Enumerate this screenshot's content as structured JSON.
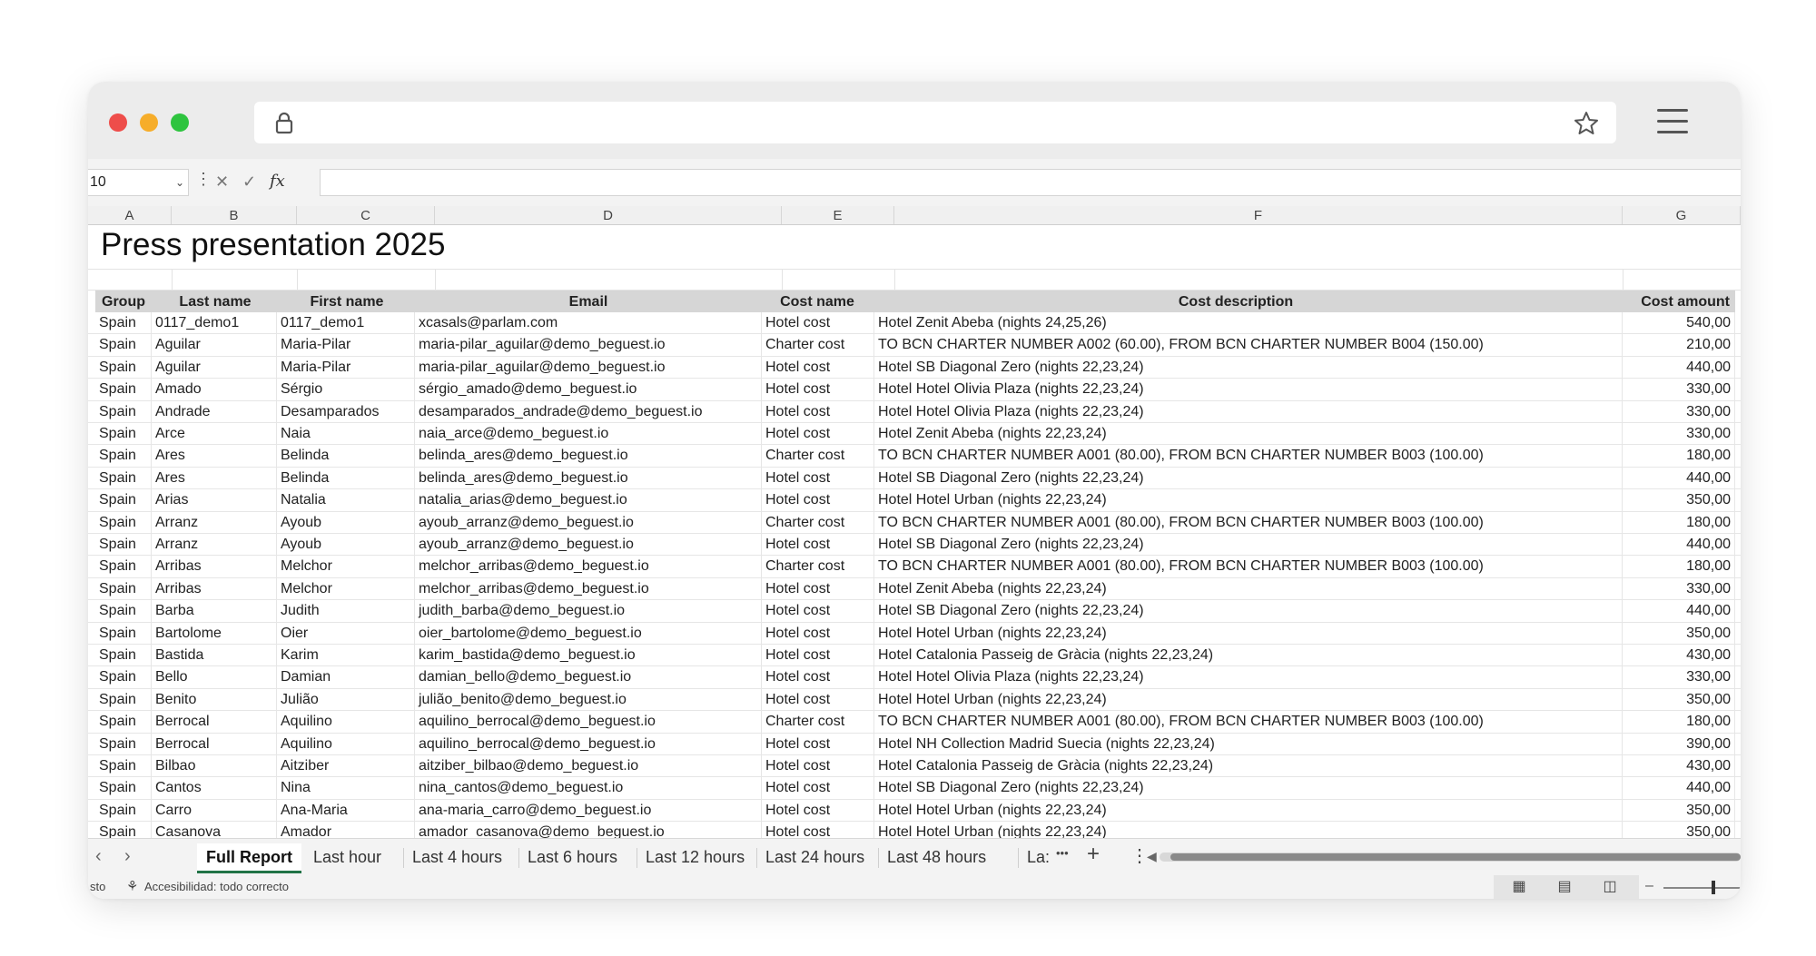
{
  "browser": {
    "star_icon": "star-icon",
    "lock_icon": "lock-icon",
    "menu_icon": "hamburger-menu-icon",
    "traffic": {
      "close": "#ee4d4a",
      "minimize": "#f6ad2a",
      "maximize": "#2ec43f"
    }
  },
  "formula_bar": {
    "name_box": "10",
    "fx": "fx"
  },
  "columns": [
    "A",
    "B",
    "C",
    "D",
    "E",
    "F",
    "G"
  ],
  "sheet_title": "Press presentation 2025",
  "headers": {
    "group": "Group",
    "last_name": "Last name",
    "first_name": "First name",
    "email": "Email",
    "cost_name": "Cost name",
    "cost_description": "Cost description",
    "cost_amount": "Cost amount"
  },
  "rows": [
    [
      "Spain",
      "0117_demo1",
      "0117_demo1",
      "xcasals@parlam.com",
      "Hotel cost",
      "Hotel Zenit Abeba (nights 24,25,26)",
      "540,00"
    ],
    [
      "Spain",
      "Aguilar",
      "Maria-Pilar",
      "maria-pilar_aguilar@demo_beguest.io",
      "Charter cost",
      "TO BCN CHARTER NUMBER A002 (60.00), FROM BCN CHARTER NUMBER B004 (150.00)",
      "210,00"
    ],
    [
      "Spain",
      "Aguilar",
      "Maria-Pilar",
      "maria-pilar_aguilar@demo_beguest.io",
      "Hotel cost",
      "Hotel SB Diagonal Zero (nights 22,23,24)",
      "440,00"
    ],
    [
      "Spain",
      "Amado",
      "Sérgio",
      "sérgio_amado@demo_beguest.io",
      "Hotel cost",
      "Hotel Hotel Olivia Plaza (nights 22,23,24)",
      "330,00"
    ],
    [
      "Spain",
      "Andrade",
      "Desamparados",
      "desamparados_andrade@demo_beguest.io",
      "Hotel cost",
      "Hotel Hotel Olivia Plaza (nights 22,23,24)",
      "330,00"
    ],
    [
      "Spain",
      "Arce",
      "Naia",
      "naia_arce@demo_beguest.io",
      "Hotel cost",
      "Hotel Zenit Abeba (nights 22,23,24)",
      "330,00"
    ],
    [
      "Spain",
      "Ares",
      "Belinda",
      "belinda_ares@demo_beguest.io",
      "Charter cost",
      "TO BCN CHARTER NUMBER A001 (80.00), FROM BCN CHARTER NUMBER B003 (100.00)",
      "180,00"
    ],
    [
      "Spain",
      "Ares",
      "Belinda",
      "belinda_ares@demo_beguest.io",
      "Hotel cost",
      "Hotel SB Diagonal Zero (nights 22,23,24)",
      "440,00"
    ],
    [
      "Spain",
      "Arias",
      "Natalia",
      "natalia_arias@demo_beguest.io",
      "Hotel cost",
      "Hotel Hotel Urban (nights 22,23,24)",
      "350,00"
    ],
    [
      "Spain",
      "Arranz",
      "Ayoub",
      "ayoub_arranz@demo_beguest.io",
      "Charter cost",
      "TO BCN CHARTER NUMBER A001 (80.00), FROM BCN CHARTER NUMBER B003 (100.00)",
      "180,00"
    ],
    [
      "Spain",
      "Arranz",
      "Ayoub",
      "ayoub_arranz@demo_beguest.io",
      "Hotel cost",
      "Hotel SB Diagonal Zero (nights 22,23,24)",
      "440,00"
    ],
    [
      "Spain",
      "Arribas",
      "Melchor",
      "melchor_arribas@demo_beguest.io",
      "Charter cost",
      "TO BCN CHARTER NUMBER A001 (80.00), FROM BCN CHARTER NUMBER B003 (100.00)",
      "180,00"
    ],
    [
      "Spain",
      "Arribas",
      "Melchor",
      "melchor_arribas@demo_beguest.io",
      "Hotel cost",
      "Hotel Zenit Abeba (nights 22,23,24)",
      "330,00"
    ],
    [
      "Spain",
      "Barba",
      "Judith",
      "judith_barba@demo_beguest.io",
      "Hotel cost",
      "Hotel SB Diagonal Zero (nights 22,23,24)",
      "440,00"
    ],
    [
      "Spain",
      "Bartolome",
      "Oier",
      "oier_bartolome@demo_beguest.io",
      "Hotel cost",
      "Hotel Hotel Urban (nights 22,23,24)",
      "350,00"
    ],
    [
      "Spain",
      "Bastida",
      "Karim",
      "karim_bastida@demo_beguest.io",
      "Hotel cost",
      "Hotel Catalonia Passeig de Gràcia (nights 22,23,24)",
      "430,00"
    ],
    [
      "Spain",
      "Bello",
      "Damian",
      "damian_bello@demo_beguest.io",
      "Hotel cost",
      "Hotel Hotel Olivia Plaza (nights 22,23,24)",
      "330,00"
    ],
    [
      "Spain",
      "Benito",
      "Julião",
      "julião_benito@demo_beguest.io",
      "Hotel cost",
      "Hotel Hotel Urban (nights 22,23,24)",
      "350,00"
    ],
    [
      "Spain",
      "Berrocal",
      "Aquilino",
      "aquilino_berrocal@demo_beguest.io",
      "Charter cost",
      "TO BCN CHARTER NUMBER A001 (80.00), FROM BCN CHARTER NUMBER B003 (100.00)",
      "180,00"
    ],
    [
      "Spain",
      "Berrocal",
      "Aquilino",
      "aquilino_berrocal@demo_beguest.io",
      "Hotel cost",
      "Hotel NH Collection Madrid Suecia (nights 22,23,24)",
      "390,00"
    ],
    [
      "Spain",
      "Bilbao",
      "Aitziber",
      "aitziber_bilbao@demo_beguest.io",
      "Hotel cost",
      "Hotel Catalonia Passeig de Gràcia (nights 22,23,24)",
      "430,00"
    ],
    [
      "Spain",
      "Cantos",
      "Nina",
      "nina_cantos@demo_beguest.io",
      "Hotel cost",
      "Hotel SB Diagonal Zero (nights 22,23,24)",
      "440,00"
    ],
    [
      "Spain",
      "Carro",
      "Ana-Maria",
      "ana-maria_carro@demo_beguest.io",
      "Hotel cost",
      "Hotel Hotel Urban (nights 22,23,24)",
      "350,00"
    ],
    [
      "Spain",
      "Casanova",
      "Amador",
      "amador_casanova@demo_beguest.io",
      "Hotel cost",
      "Hotel Hotel Urban (nights 22,23,24)",
      "350,00"
    ]
  ],
  "tabs": [
    "Full Report",
    "Last hour",
    "Last 4 hours",
    "Last 6 hours",
    "Last 12 hours",
    "Last 24 hours",
    "Last 48 hours",
    "La:"
  ],
  "tab_controls": {
    "prev": "‹",
    "next": "›",
    "more": "•••",
    "add": "+",
    "options": "⋮"
  },
  "status": {
    "left": "sto",
    "accessibility": "Accesibilidad: todo correcto"
  }
}
